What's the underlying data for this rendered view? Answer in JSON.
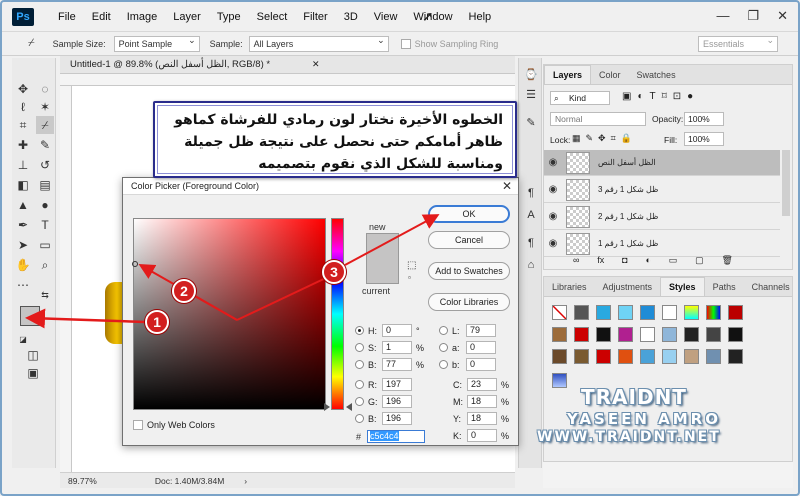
{
  "menubar": {
    "logo": "Ps",
    "items": [
      "File",
      "Edit",
      "Image",
      "Layer",
      "Type",
      "Select",
      "Filter",
      "3D",
      "View",
      "Window",
      "Help"
    ],
    "controls": [
      "—",
      "❐",
      "✕"
    ]
  },
  "options_bar": {
    "sample_size_label": "Sample Size:",
    "sample_size_value": "Point Sample",
    "sample_label": "Sample:",
    "sample_value": "All Layers",
    "show_ring_label": "Show Sampling Ring",
    "workspace_value": "Essentials"
  },
  "document": {
    "tab_title": "Untitled-1 @ 89.8% (الظل أسفل النص, RGB/8) *",
    "zoom": "89.77%",
    "doc_info": "Doc: 1.40M/3.84M"
  },
  "layers_panel": {
    "tabs": [
      "Layers",
      "Color",
      "Swatches"
    ],
    "filter_kind": "Kind",
    "blend_mode": "Normal",
    "opacity_label": "Opacity:",
    "opacity_value": "100%",
    "lock_label": "Lock:",
    "fill_label": "Fill:",
    "fill_value": "100%",
    "layers": [
      {
        "name": "الظل أسفل النص"
      },
      {
        "name": "ظل شكل 1 رقم 3"
      },
      {
        "name": "ظل شكل 1 رقم 2"
      },
      {
        "name": "ظل شكل 1 رقم 1"
      }
    ],
    "footer_icons": [
      "∞",
      "fx",
      "◘",
      "◐",
      "▭",
      "▢",
      "🗑"
    ]
  },
  "styles_panel": {
    "tabs": [
      "Libraries",
      "Adjustments",
      "Styles",
      "Paths",
      "Channels"
    ]
  },
  "color_picker": {
    "title": "Color Picker (Foreground Color)",
    "new_label": "new",
    "current_label": "current",
    "new_color": "#c5c4c4",
    "current_color": "#c5c4c4",
    "buttons": {
      "ok": "OK",
      "cancel": "Cancel",
      "add_to_swatches": "Add to Swatches",
      "color_libraries": "Color Libraries"
    },
    "fields": {
      "H": {
        "value": "0",
        "unit": "°"
      },
      "S": {
        "value": "1",
        "unit": "%"
      },
      "B": {
        "value": "77",
        "unit": "%"
      },
      "R": {
        "value": "197",
        "unit": ""
      },
      "G": {
        "value": "196",
        "unit": ""
      },
      "Bb": {
        "value": "196",
        "unit": ""
      },
      "L": {
        "value": "79",
        "unit": ""
      },
      "a": {
        "value": "0",
        "unit": ""
      },
      "b": {
        "value": "0",
        "unit": ""
      },
      "C": {
        "value": "23",
        "unit": "%"
      },
      "M": {
        "value": "18",
        "unit": "%"
      },
      "Y": {
        "value": "18",
        "unit": "%"
      },
      "K": {
        "value": "0",
        "unit": "%"
      }
    },
    "hex_label": "#",
    "hex_value": "c5c4c4",
    "only_web_colors": "Only Web Colors"
  },
  "callout": {
    "line1": "الخطوه الأخيرة نختار لون رمادي للفرشاة كماهو",
    "line2": "ظاهر أمامكم حتى نحصل على نتيجة ظل جميلة",
    "line3": "ومناسبة للشكل الذي نقوم بتصميمه"
  },
  "steps": [
    "1",
    "2",
    "3"
  ],
  "watermark": {
    "line1": "TRAIDNT",
    "line2": "YASEEN AMRO",
    "line3": "WWW.TRAIDNT.NET"
  },
  "colors": {
    "accent": "#3a7bd5",
    "step_red": "#d21f1f",
    "callout_border": "#2a2c8c",
    "arrow_red": "#e31b1b"
  }
}
